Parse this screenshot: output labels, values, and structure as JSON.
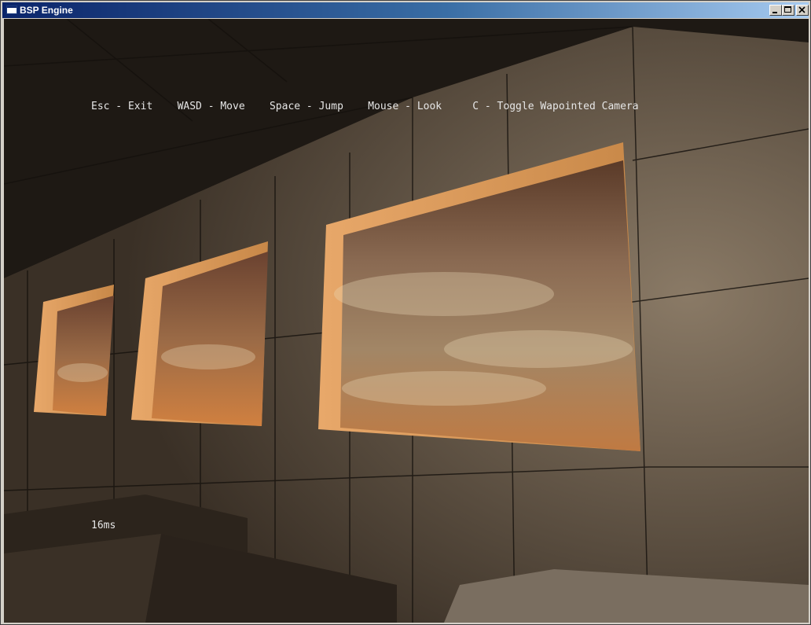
{
  "window": {
    "title": "BSP Engine",
    "icon": "app-window-icon",
    "controls": [
      "minimize-icon",
      "maximize-icon",
      "close-icon"
    ]
  },
  "hud": {
    "controls_text": "Esc - Exit    WASD - Move    Space - Jump    Mouse - Look     C - Toggle Wapointed Camera",
    "frame_time": "16ms"
  }
}
